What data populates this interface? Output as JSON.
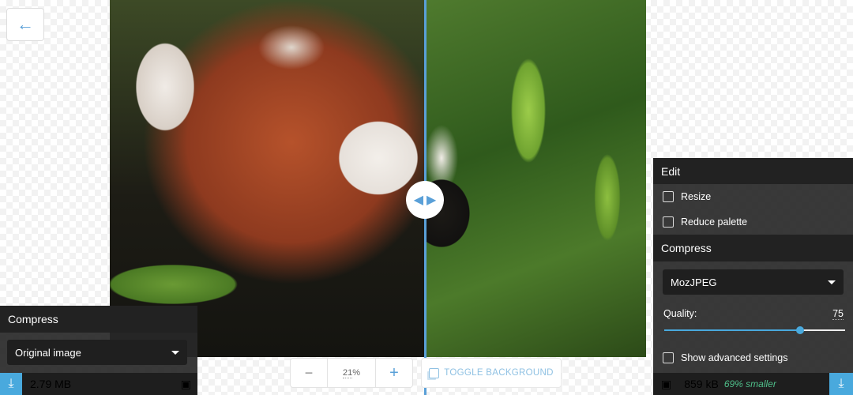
{
  "back_button": {
    "icon": "arrow-left-icon"
  },
  "left_panel": {
    "header": "Compress",
    "method": "Original image",
    "size": "2.79 MB"
  },
  "right_panel": {
    "edit_header": "Edit",
    "resize_label": "Resize",
    "resize_checked": false,
    "reduce_palette_label": "Reduce palette",
    "reduce_palette_checked": false,
    "compress_header": "Compress",
    "method": "MozJPEG",
    "quality_label": "Quality:",
    "quality_value": "75",
    "quality_fraction": 0.75,
    "advanced_label": "Show advanced settings",
    "advanced_checked": false,
    "size": "859 kB",
    "savings": "69% smaller"
  },
  "zoom": {
    "minus": "−",
    "value": "21",
    "unit": "%",
    "plus": "+"
  },
  "toggle_background": {
    "label": "TOGGLE BACKGROUND"
  },
  "colors": {
    "accent": "#49a9dd",
    "savings_green": "#4fbf8a"
  }
}
